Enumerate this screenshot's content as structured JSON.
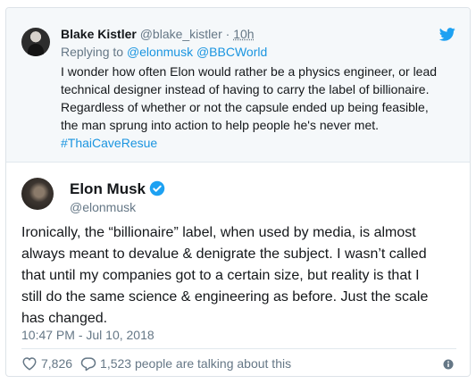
{
  "reply_tweet": {
    "display_name": "Blake Kistler",
    "handle": "@blake_kistler",
    "separator": "·",
    "time": "10h",
    "replying_label": "Replying to",
    "replying_to_1": "@elonmusk",
    "replying_to_2": "@BBCWorld",
    "text_lines": [
      "I wonder how often Elon would rather be a physics engineer, or lead",
      "technical designer instead of having to carry the label of billionaire.",
      "Regardless of whether or not the capsule ended up being feasible,",
      "the man sprung into action to help people he's never met."
    ],
    "hashtag": "#ThaiCaveResue"
  },
  "main_tweet": {
    "display_name": "Elon Musk",
    "handle": "@elonmusk",
    "text_lines": [
      "Ironically, the “billionaire” label, when used by media, is almost",
      "always meant to devalue & denigrate the subject. I wasn’t called",
      "that until my companies got to a certain size, but reality is that I",
      "still do the same science & engineering as before. Just the scale",
      "has changed."
    ],
    "timestamp": "10:47 PM - Jul 10, 2018",
    "likes": "7,826",
    "conversation": "1,523 people are talking about this"
  },
  "icons": {
    "brand": "twitter-bird-icon",
    "verified": "verified-badge-icon",
    "like": "heart-icon",
    "reply": "speech-bubble-icon",
    "info": "info-icon"
  },
  "colors": {
    "brand_blue": "#1da1f2",
    "link_blue": "#1b95e0",
    "text": "#14171a",
    "muted": "#657786",
    "reply_bg": "#f5f8fa"
  }
}
